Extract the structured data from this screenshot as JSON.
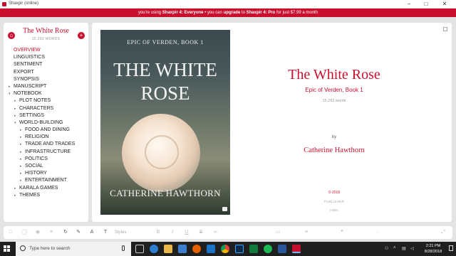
{
  "window": {
    "title": "Shaxpir (online)",
    "minimize": "–",
    "maximize": "□",
    "close": "✕"
  },
  "promo": {
    "p1": "you're using ",
    "b1": "Shaxpir 4: Everyone",
    "p2": " • you can ",
    "b2": "upgrade",
    "p3": " to ",
    "b3": "Shaxpir 4: Pro",
    "p4": " for just $7.99 a month"
  },
  "sidebar": {
    "book_title": "The White Rose",
    "word_count": "15,293 WORDS",
    "home_icon": "home-icon",
    "add_icon": "plus-icon",
    "items": [
      {
        "label": "OVERVIEW",
        "active": true
      },
      {
        "label": "LINGUISTICS"
      },
      {
        "label": "SENTIMENT"
      },
      {
        "label": "EXPORT"
      },
      {
        "label": "SYNOPSIS"
      },
      {
        "label": "MANUSCRIPT",
        "arrow": "▸"
      },
      {
        "label": "NOTEBOOK",
        "arrow": "▾"
      },
      {
        "label": "PLOT NOTES",
        "arrow": "▸"
      },
      {
        "label": "CHARACTERS",
        "arrow": "▸"
      },
      {
        "label": "SETTINGS",
        "arrow": "▸"
      },
      {
        "label": "WORLD-BUILDING",
        "arrow": "▾"
      },
      {
        "label": "FOOD AND DINING",
        "arrow": "▸"
      },
      {
        "label": "RELIGION",
        "arrow": "▸"
      },
      {
        "label": "TRADE AND TRADES",
        "arrow": "▸"
      },
      {
        "label": "INFRASTRUCTURE",
        "arrow": "▸"
      },
      {
        "label": "POLITICS",
        "arrow": "▸"
      },
      {
        "label": "SOCIAL",
        "arrow": "▸"
      },
      {
        "label": "HISTORY",
        "arrow": "▸"
      },
      {
        "label": "ENTERTAINMENT",
        "arrow": "▸"
      },
      {
        "label": "KARALA GAMES",
        "arrow": "▸"
      },
      {
        "label": "THEMES",
        "arrow": "▸"
      }
    ]
  },
  "cover": {
    "series": "Epic of Verden, Book 1",
    "title_line1": "The White",
    "title_line2": "Rose",
    "author": "Catherine Hawthorn",
    "camera_icon": "camera-icon"
  },
  "overview": {
    "title": "The White Rose",
    "subtitle": "Epic of Verden, Book 1",
    "words": "15,293 words",
    "by": "by",
    "author": "Catherine Hawthorn",
    "copyright": "© 2018",
    "publisher": "PUBLISHER",
    "isbn": "ISBN"
  },
  "toolbar": {
    "style_placeholder": "Styles",
    "icons": [
      "square-icon",
      "comment-icon",
      "eye-icon",
      "list-icon",
      "refresh-icon",
      "pen-icon",
      "text-color-icon",
      "text-style-icon",
      "bold-icon",
      "italic-icon",
      "underline-icon",
      "strikethrough-icon",
      "link-icon",
      "image-icon",
      "align-icon",
      "quote-icon",
      "chat-icon",
      "expand-icon"
    ]
  },
  "taskbar": {
    "search_placeholder": "Type here to search",
    "time": "2:21 PM",
    "date": "8/28/2018",
    "apps": [
      "task-view-icon",
      "edge-icon",
      "file-explorer-icon",
      "store-icon",
      "firefox-icon",
      "mail-icon",
      "chrome-icon",
      "photoshop-icon",
      "solitaire-icon",
      "spotify-icon",
      "word-icon",
      "shaxpir-icon"
    ],
    "colors": {
      "accent": "#c8102e"
    }
  }
}
